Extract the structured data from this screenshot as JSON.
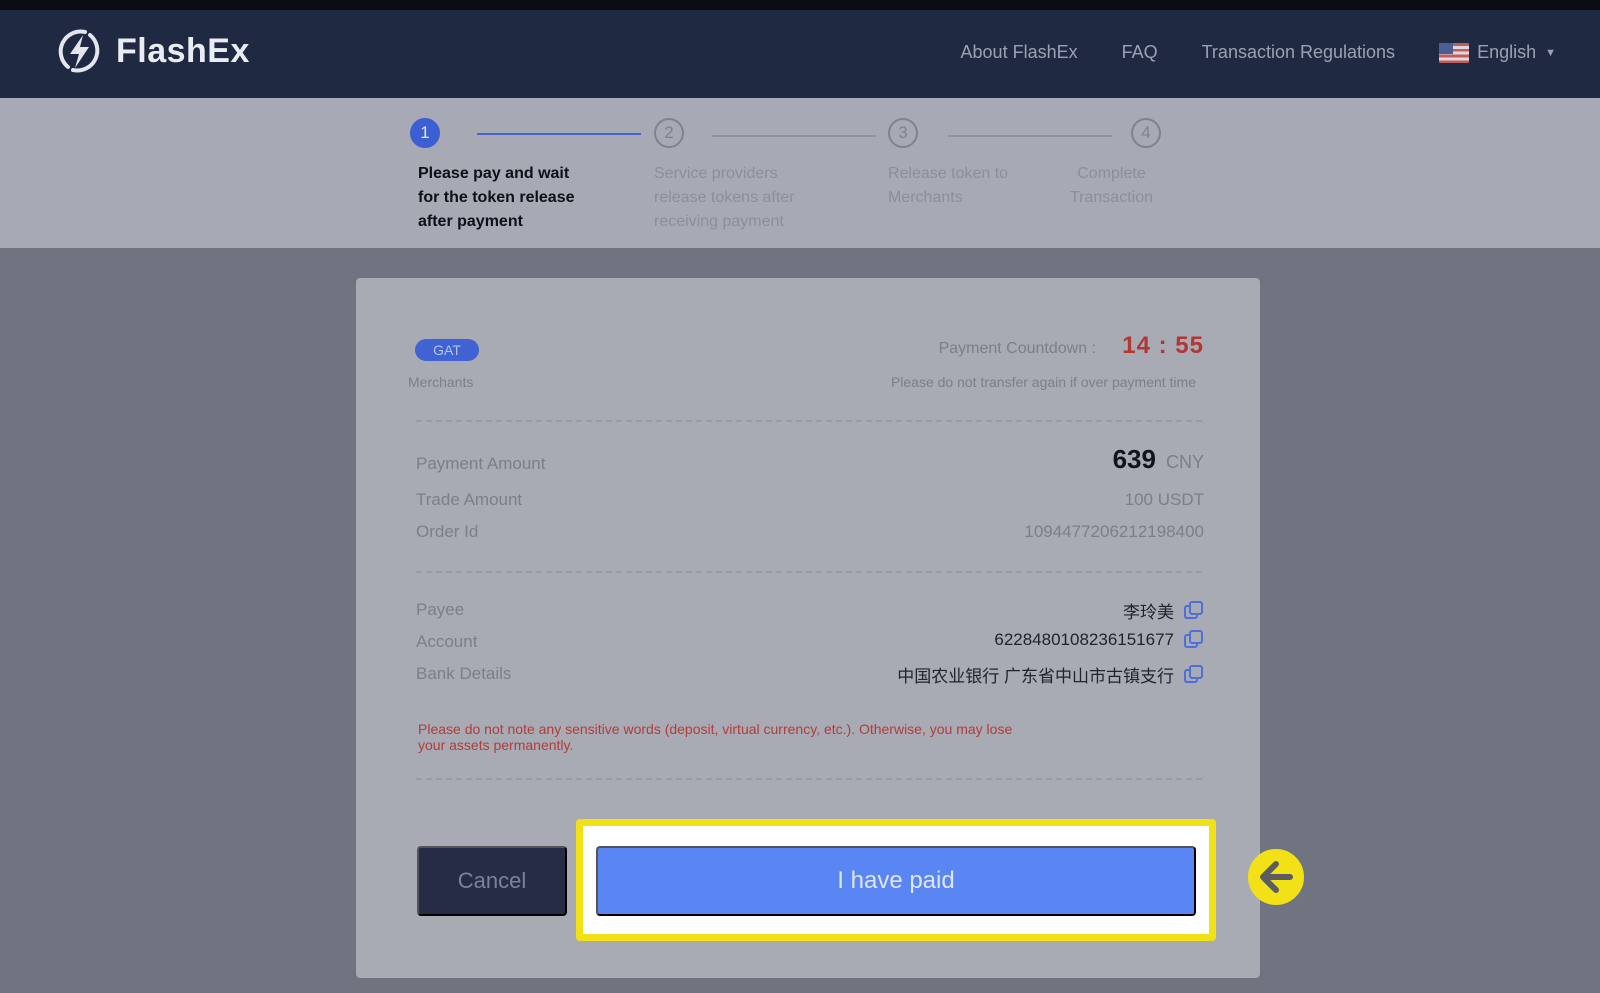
{
  "brand": {
    "name": "FlashEx",
    "logo_icon": "lightning-bolt-icon"
  },
  "nav": {
    "links": [
      "About FlashEx",
      "FAQ",
      "Transaction Regulations"
    ],
    "language": "English",
    "flag_icon": "us-flag-icon"
  },
  "steps": [
    {
      "number": "1",
      "lines": [
        "Please pay and wait",
        "for the token release",
        "after payment"
      ],
      "active": true
    },
    {
      "number": "2",
      "lines": [
        "Service providers",
        "release tokens after",
        "receiving payment"
      ],
      "active": false
    },
    {
      "number": "3",
      "lines": [
        "Release token to",
        "Merchants"
      ],
      "active": false
    },
    {
      "number": "4",
      "lines": [
        "Complete",
        "Transaction"
      ],
      "active": false
    }
  ],
  "payment": {
    "badge": "GAT",
    "merchant_label": "Merchants",
    "countdown_label": "Payment Countdown :",
    "countdown_value": "14 : 55",
    "countdown_note": "Please do not transfer again if over payment time",
    "payment_amount_label": "Payment Amount",
    "payment_amount_value": "639",
    "payment_amount_currency": "CNY",
    "trade_amount_label": "Trade Amount",
    "trade_amount_value": "100 USDT",
    "order_id_label": "Order Id",
    "order_id_value": "1094477206212198400",
    "payee_label": "Payee",
    "payee_value": "李玲美",
    "account_label": "Account",
    "account_value": "6228480108236151677",
    "bank_label": "Bank Details",
    "bank_value": "中国农业银行 广东省中山市古镇支行",
    "warning_lines": [
      "Please do not note any sensitive words (deposit, virtual currency, etc.). Otherwise, you may lose",
      "your assets permanently."
    ]
  },
  "actions": {
    "cancel_label": "Cancel",
    "paid_label": "I have paid"
  },
  "colors": {
    "highlight": "#f3e117",
    "primary_button": "#5a86f3",
    "cancel_button": "#262b46",
    "countdown": "#b53535",
    "warning": "#b33b3b",
    "navbar": "#1f2941"
  },
  "annotation_icon": "arrow-left-circle-icon"
}
